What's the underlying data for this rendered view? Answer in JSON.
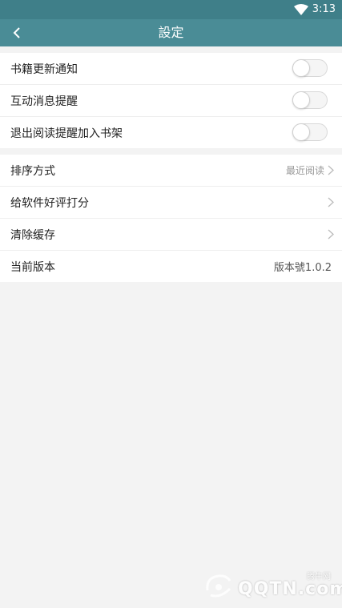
{
  "status_bar": {
    "time": "3:13",
    "icons": [
      "wifi-icon"
    ]
  },
  "app_bar": {
    "title": "設定",
    "back_icon": "chevron-left-icon"
  },
  "notification_settings": [
    {
      "label": "书籍更新通知",
      "toggle_on": false
    },
    {
      "label": "互动消息提醒",
      "toggle_on": false
    },
    {
      "label": "退出阅读提醒加入书架",
      "toggle_on": false
    }
  ],
  "general_settings": [
    {
      "label": "排序方式",
      "value": "最近阅读",
      "chevron": true
    },
    {
      "label": "给软件好评打分",
      "value": "",
      "chevron": true
    },
    {
      "label": "清除缓存",
      "value": "",
      "chevron": true
    },
    {
      "label": "当前版本",
      "value": "版本號1.0.2",
      "chevron": false
    }
  ],
  "watermark": {
    "brand": "QQTN.com",
    "small": "腾牛网"
  },
  "colors": {
    "status_bar": "#3f7f89",
    "app_bar": "#4a8c96",
    "background": "#f3f3f3"
  }
}
